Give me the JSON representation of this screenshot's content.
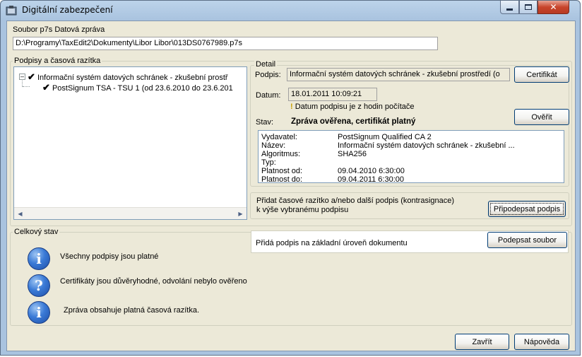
{
  "window": {
    "title": "Digitální zabezpečení"
  },
  "file": {
    "label": "Soubor p7s Datová zpráva",
    "path": "D:\\Programy\\TaxEdit2\\Dokumenty\\Libor Libor\\013DS0767989.p7s"
  },
  "signatures": {
    "group_title": "Podpisy a časová razítka",
    "tree": [
      {
        "label": "Informační systém datových schránek - zkušební prostř"
      },
      {
        "label": "PostSignum TSA - TSU 1 (od 23.6.2010 do 23.6.201"
      }
    ]
  },
  "detail": {
    "group_title": "Detail",
    "signature_label": "Podpis:",
    "signature_value": "Informační systém datových schránek - zkušební prostředí (o",
    "certificate_button": "Certifikát",
    "date_label": "Datum:",
    "date_value": "18.01.2011 10:09:21",
    "date_note": "Datum podpisu je z hodin počítače",
    "status_label": "Stav:",
    "status_value": "Zpráva ověřena, certifikát platný",
    "verify_button": "Ověřit",
    "cert_info": [
      {
        "key": "Vydavatel:",
        "value": "PostSignum Qualified CA 2"
      },
      {
        "key": "Název:",
        "value": "Informační systém datových schránek - zkušební ..."
      },
      {
        "key": "Algoritmus:",
        "value": "SHA256"
      },
      {
        "key": "Typ:",
        "value": ""
      },
      {
        "key": "Platnost od:",
        "value": "09.04.2010 6:30:00"
      },
      {
        "key": "Platnost do:",
        "value": "09.04.2011 6:30:00"
      }
    ]
  },
  "cosign": {
    "text_line1": "Přidat časové razítko a/nebo další podpis (kontrasignace)",
    "text_line2": "k výše vybranému podpisu",
    "button": "Připodepsat podpis"
  },
  "sign_doc": {
    "text": "Přidá podpis na základní úroveň dokumentu",
    "button": "Podepsat soubor"
  },
  "overall": {
    "group_title": "Celkový stav",
    "items": [
      {
        "icon": "info-icon",
        "glyph": "i",
        "text": "Všechny podpisy jsou platné"
      },
      {
        "icon": "question-icon",
        "glyph": "?",
        "text": "Certifikáty jsou důvěryhodné, odvolání nebylo ověřeno"
      },
      {
        "icon": "info-icon",
        "glyph": "i",
        "text": "Zpráva obsahuje platná časová razítka."
      }
    ]
  },
  "footer": {
    "close_button": "Zavřít",
    "help_button": "Nápověda"
  },
  "colors": {
    "titlebar": "#bcd3ea",
    "client_bg": "#ece9d8",
    "close_button": "#c8452c",
    "info_icon": "#3a7ad6"
  }
}
